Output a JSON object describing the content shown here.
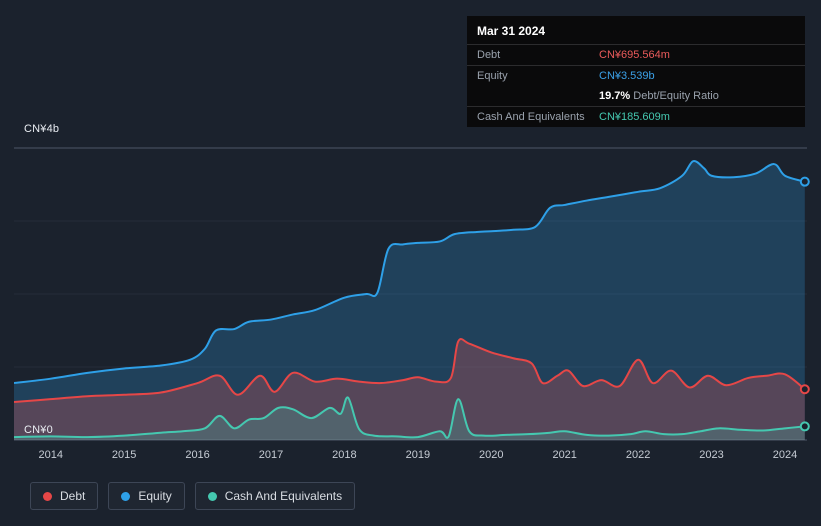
{
  "bg_color": "#1b222d",
  "tooltip": {
    "date": "Mar 31 2024",
    "rows": {
      "debt": {
        "label": "Debt",
        "value": "CN¥695.564m",
        "color": "#eb5b5b"
      },
      "equity": {
        "label": "Equity",
        "value": "CN¥3.539b",
        "color": "#3ba1e8"
      },
      "ratio": {
        "value": "19.7%",
        "label": "Debt/Equity Ratio"
      },
      "cash": {
        "label": "Cash And Equivalents",
        "value": "CN¥185.609m",
        "color": "#45c8b0"
      }
    }
  },
  "legend": {
    "items": [
      {
        "label": "Debt",
        "color": "#e64747"
      },
      {
        "label": "Equity",
        "color": "#2ea0e8"
      },
      {
        "label": "Cash And Equivalents",
        "color": "#45c8b0"
      }
    ]
  },
  "chart_data": {
    "type": "area",
    "title": "Debt, Equity and Cash history (CN¥ billions)",
    "unit": "CN¥ billions",
    "x_domain": [
      2013.5,
      2024.3
    ],
    "ylim": [
      0,
      4
    ],
    "y_gridlines": [
      0,
      1,
      2,
      3,
      4
    ],
    "y_label_top": "CN¥4b",
    "y_label_bottom": "CN¥0",
    "grid_major_color": "#4d5766",
    "grid_minor_color": "#242c39",
    "x_ticks": [
      {
        "value": 2014,
        "label": "2014"
      },
      {
        "value": 2015,
        "label": "2015"
      },
      {
        "value": 2016,
        "label": "2016"
      },
      {
        "value": 2017,
        "label": "2017"
      },
      {
        "value": 2018,
        "label": "2018"
      },
      {
        "value": 2019,
        "label": "2019"
      },
      {
        "value": 2020,
        "label": "2020"
      },
      {
        "value": 2021,
        "label": "2021"
      },
      {
        "value": 2022,
        "label": "2022"
      },
      {
        "value": 2023,
        "label": "2023"
      },
      {
        "value": 2024,
        "label": "2024"
      }
    ],
    "series": [
      {
        "name": "Equity",
        "color": "#2ea0e8",
        "fill": "rgba(46,160,232,0.25)",
        "points": [
          [
            2013.5,
            0.78
          ],
          [
            2014.0,
            0.84
          ],
          [
            2014.5,
            0.92
          ],
          [
            2015.0,
            0.98
          ],
          [
            2015.5,
            1.02
          ],
          [
            2015.9,
            1.1
          ],
          [
            2016.1,
            1.25
          ],
          [
            2016.25,
            1.5
          ],
          [
            2016.5,
            1.52
          ],
          [
            2016.7,
            1.62
          ],
          [
            2017.0,
            1.65
          ],
          [
            2017.3,
            1.72
          ],
          [
            2017.6,
            1.78
          ],
          [
            2018.0,
            1.95
          ],
          [
            2018.3,
            2.0
          ],
          [
            2018.45,
            2.02
          ],
          [
            2018.6,
            2.62
          ],
          [
            2018.8,
            2.68
          ],
          [
            2019.0,
            2.7
          ],
          [
            2019.3,
            2.72
          ],
          [
            2019.5,
            2.82
          ],
          [
            2019.8,
            2.85
          ],
          [
            2020.0,
            2.86
          ],
          [
            2020.3,
            2.88
          ],
          [
            2020.6,
            2.92
          ],
          [
            2020.8,
            3.18
          ],
          [
            2021.0,
            3.22
          ],
          [
            2021.3,
            3.28
          ],
          [
            2021.6,
            3.33
          ],
          [
            2022.0,
            3.4
          ],
          [
            2022.3,
            3.45
          ],
          [
            2022.6,
            3.62
          ],
          [
            2022.75,
            3.82
          ],
          [
            2022.9,
            3.72
          ],
          [
            2023.0,
            3.62
          ],
          [
            2023.3,
            3.6
          ],
          [
            2023.6,
            3.65
          ],
          [
            2023.85,
            3.78
          ],
          [
            2024.0,
            3.62
          ],
          [
            2024.27,
            3.539
          ]
        ]
      },
      {
        "name": "Debt",
        "color": "#e64747",
        "fill": "rgba(226,85,85,0.28)",
        "points": [
          [
            2013.5,
            0.52
          ],
          [
            2014.0,
            0.56
          ],
          [
            2014.5,
            0.6
          ],
          [
            2015.0,
            0.62
          ],
          [
            2015.5,
            0.65
          ],
          [
            2016.0,
            0.78
          ],
          [
            2016.3,
            0.88
          ],
          [
            2016.55,
            0.62
          ],
          [
            2016.85,
            0.88
          ],
          [
            2017.05,
            0.66
          ],
          [
            2017.3,
            0.92
          ],
          [
            2017.6,
            0.8
          ],
          [
            2017.9,
            0.84
          ],
          [
            2018.2,
            0.8
          ],
          [
            2018.5,
            0.78
          ],
          [
            2018.8,
            0.82
          ],
          [
            2019.0,
            0.86
          ],
          [
            2019.25,
            0.8
          ],
          [
            2019.45,
            0.85
          ],
          [
            2019.55,
            1.35
          ],
          [
            2019.7,
            1.32
          ],
          [
            2020.0,
            1.2
          ],
          [
            2020.3,
            1.12
          ],
          [
            2020.55,
            1.05
          ],
          [
            2020.7,
            0.78
          ],
          [
            2020.9,
            0.88
          ],
          [
            2021.05,
            0.95
          ],
          [
            2021.25,
            0.74
          ],
          [
            2021.5,
            0.82
          ],
          [
            2021.75,
            0.74
          ],
          [
            2022.0,
            1.1
          ],
          [
            2022.2,
            0.78
          ],
          [
            2022.45,
            0.95
          ],
          [
            2022.7,
            0.72
          ],
          [
            2022.95,
            0.88
          ],
          [
            2023.2,
            0.75
          ],
          [
            2023.5,
            0.85
          ],
          [
            2023.75,
            0.88
          ],
          [
            2024.0,
            0.9
          ],
          [
            2024.27,
            0.695
          ]
        ]
      },
      {
        "name": "Cash And Equivalents",
        "color": "#45c8b0",
        "fill": "rgba(69,200,176,0.22)",
        "points": [
          [
            2013.5,
            0.04
          ],
          [
            2014.0,
            0.05
          ],
          [
            2014.5,
            0.04
          ],
          [
            2015.0,
            0.06
          ],
          [
            2015.5,
            0.1
          ],
          [
            2015.8,
            0.12
          ],
          [
            2016.1,
            0.16
          ],
          [
            2016.3,
            0.33
          ],
          [
            2016.5,
            0.16
          ],
          [
            2016.7,
            0.28
          ],
          [
            2016.9,
            0.3
          ],
          [
            2017.1,
            0.44
          ],
          [
            2017.3,
            0.42
          ],
          [
            2017.55,
            0.3
          ],
          [
            2017.8,
            0.44
          ],
          [
            2017.95,
            0.36
          ],
          [
            2018.05,
            0.58
          ],
          [
            2018.2,
            0.15
          ],
          [
            2018.4,
            0.06
          ],
          [
            2018.7,
            0.05
          ],
          [
            2019.0,
            0.04
          ],
          [
            2019.3,
            0.12
          ],
          [
            2019.42,
            0.05
          ],
          [
            2019.55,
            0.56
          ],
          [
            2019.7,
            0.12
          ],
          [
            2019.9,
            0.06
          ],
          [
            2020.2,
            0.07
          ],
          [
            2020.5,
            0.08
          ],
          [
            2020.8,
            0.1
          ],
          [
            2021.0,
            0.12
          ],
          [
            2021.3,
            0.07
          ],
          [
            2021.6,
            0.06
          ],
          [
            2021.9,
            0.08
          ],
          [
            2022.1,
            0.12
          ],
          [
            2022.35,
            0.08
          ],
          [
            2022.6,
            0.08
          ],
          [
            2022.85,
            0.12
          ],
          [
            2023.1,
            0.16
          ],
          [
            2023.4,
            0.14
          ],
          [
            2023.7,
            0.13
          ],
          [
            2024.0,
            0.16
          ],
          [
            2024.27,
            0.186
          ]
        ]
      }
    ]
  }
}
